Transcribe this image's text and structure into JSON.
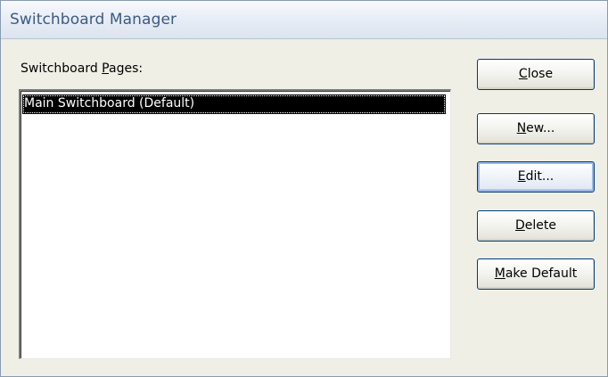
{
  "window": {
    "title": "Switchboard Manager"
  },
  "pages_label": {
    "before": "Switchboard ",
    "accel": "P",
    "after": "ages:"
  },
  "pages_list": {
    "items": [
      {
        "label": "Main Switchboard (Default)",
        "selected": true
      }
    ]
  },
  "buttons": {
    "close": {
      "accel": "C",
      "rest": "lose"
    },
    "new": {
      "accel": "N",
      "rest": "ew..."
    },
    "edit": {
      "accel": "E",
      "rest": "dit..."
    },
    "delete": {
      "accel": "D",
      "rest": "elete"
    },
    "make_default": {
      "accel": "M",
      "rest": "ake Default"
    }
  },
  "colors": {
    "title_text": "#3b5a84",
    "selection_bg": "#000000",
    "selection_text": "#ffffff",
    "button_border": "#003c74"
  }
}
